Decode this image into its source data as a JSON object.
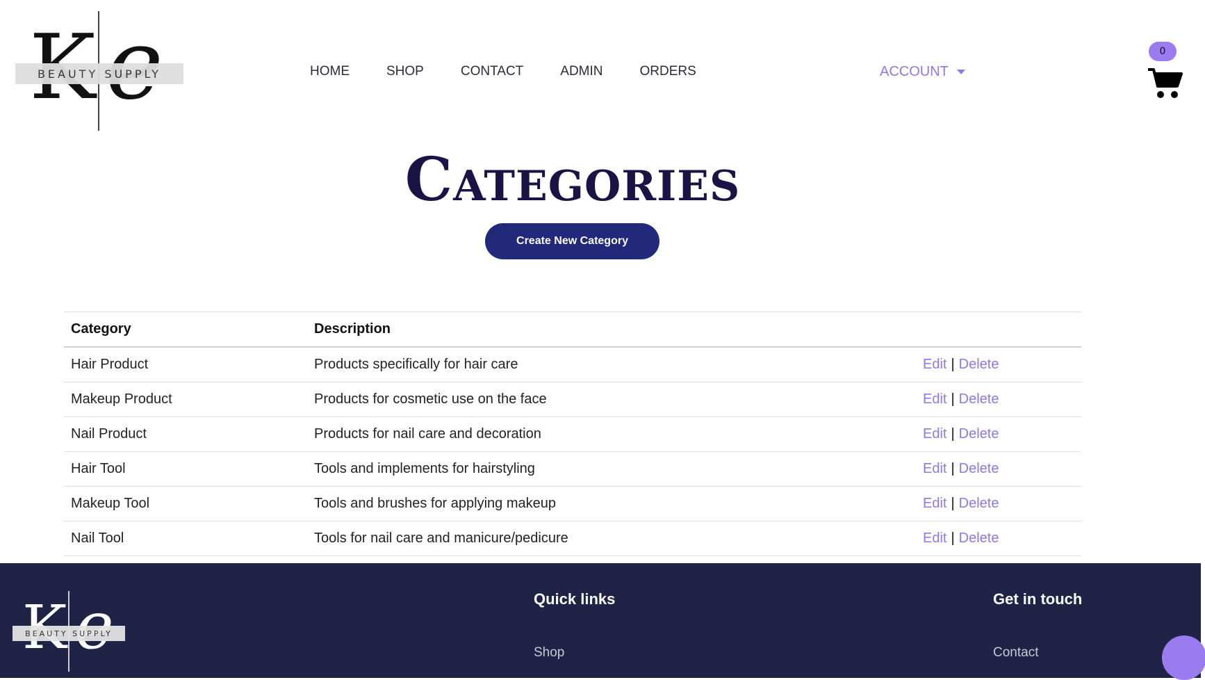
{
  "brand": {
    "logo_letters_left": "K",
    "logo_letters_right": "e",
    "logo_text": "BEAUTY SUPPLY"
  },
  "nav": {
    "home": "HOME",
    "shop": "SHOP",
    "contact": "CONTACT",
    "admin": "ADMIN",
    "orders": "ORDERS"
  },
  "account": {
    "label": "ACCOUNT",
    "icon": "chevron-down-icon"
  },
  "cart": {
    "count": "0",
    "icon": "cart-icon"
  },
  "page": {
    "title": "Categories",
    "create_button": "Create New Category"
  },
  "table": {
    "headers": [
      "Category",
      "Description",
      ""
    ],
    "rows": [
      {
        "category": "Hair Product",
        "description": "Products specifically for hair care",
        "edit": "Edit",
        "sep": "|",
        "delete": "Delete"
      },
      {
        "category": "Makeup Product",
        "description": "Products for cosmetic use on the face",
        "edit": "Edit",
        "sep": "|",
        "delete": "Delete"
      },
      {
        "category": "Nail Product",
        "description": "Products for nail care and decoration",
        "edit": "Edit",
        "sep": "|",
        "delete": "Delete"
      },
      {
        "category": "Hair Tool",
        "description": "Tools and implements for hairstyling",
        "edit": "Edit",
        "sep": "|",
        "delete": "Delete"
      },
      {
        "category": "Makeup Tool",
        "description": "Tools and brushes for applying makeup",
        "edit": "Edit",
        "sep": "|",
        "delete": "Delete"
      },
      {
        "category": "Nail Tool",
        "description": "Tools for nail care and manicure/pedicure",
        "edit": "Edit",
        "sep": "|",
        "delete": "Delete"
      }
    ]
  },
  "footer": {
    "quick_links_title": "Quick links",
    "quick_links": [
      "Shop"
    ],
    "get_in_touch_title": "Get in touch",
    "get_in_touch_links": [
      "Contact"
    ]
  },
  "colors": {
    "accent": "#8f78e6",
    "primary": "#22297a",
    "title": "#1a1446",
    "footer_bg": "#1f2447",
    "badge": "#9a7cf0"
  }
}
